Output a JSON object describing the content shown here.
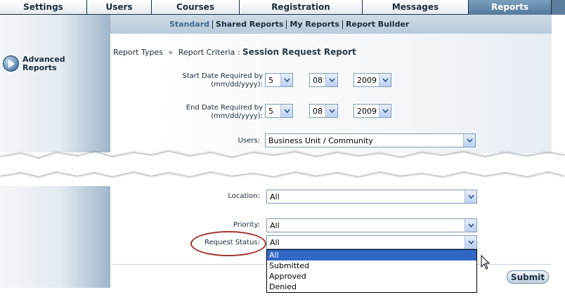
{
  "tabs": [
    {
      "label": "Settings",
      "width": 124,
      "active": false
    },
    {
      "label": "Users",
      "width": 92,
      "active": false
    },
    {
      "label": "Courses",
      "width": 125,
      "active": false
    },
    {
      "label": "Registration",
      "width": 175,
      "active": false
    },
    {
      "label": "Messages",
      "width": 151,
      "active": false
    },
    {
      "label": "Reports",
      "width": 118,
      "active": true
    }
  ],
  "subnav": [
    "Standard",
    "Shared Reports",
    "My Reports",
    "Report Builder"
  ],
  "sidebar": {
    "advanced_reports": "Advanced Reports"
  },
  "breadcrumb": {
    "part1": "Report Types",
    "sep": "»",
    "part2": "Report Criteria",
    "colon": ":",
    "title": "Session Request Report"
  },
  "form": {
    "start_label": "Start Date Required by (mm/dd/yyyy):",
    "start": {
      "month": "5",
      "day": "08",
      "year": "2009"
    },
    "end_label": "End Date Required by (mm/dd/yyyy):",
    "end": {
      "month": "5",
      "day": "08",
      "year": "2009"
    },
    "users_label": "Users:",
    "users_value": "Business Unit / Community",
    "location_label": "Location:",
    "location_value": "All",
    "priority_label": "Priority:",
    "priority_value": "All",
    "status_label": "Request Status:",
    "status_value": "All",
    "status_options": [
      "All",
      "Submitted",
      "Approved",
      "Denied"
    ],
    "submit": "Submit"
  },
  "colors": {
    "annotation": "#a0302c",
    "selection": "#3168c6",
    "tab_active": "#5b7d9c"
  }
}
